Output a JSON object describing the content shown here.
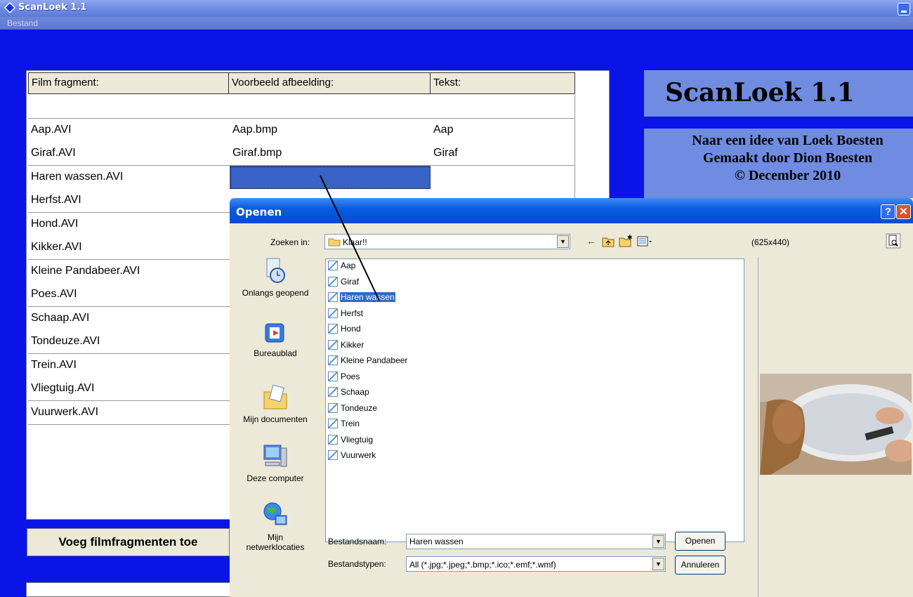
{
  "window": {
    "title": "ScanLoek 1.1"
  },
  "menu": {
    "items": [
      {
        "label": "Bestand"
      }
    ]
  },
  "grid": {
    "headers": [
      "Film fragment:",
      "Voorbeeld afbeelding:",
      "Tekst:"
    ],
    "rows": [
      [
        "",
        "",
        ""
      ],
      [
        "Aap.AVI",
        "Aap.bmp",
        "Aap"
      ],
      [
        "Giraf.AVI",
        "Giraf.bmp",
        "Giraf"
      ],
      [
        "Haren wassen.AVI",
        "",
        ""
      ],
      [
        "Herfst.AVI",
        "",
        ""
      ],
      [
        "Hond.AVI",
        "",
        ""
      ],
      [
        "Kikker.AVI",
        "",
        ""
      ],
      [
        "Kleine Pandabeer.AVI",
        "",
        ""
      ],
      [
        "Poes.AVI",
        "",
        ""
      ],
      [
        "Schaap.AVI",
        "",
        ""
      ],
      [
        "Tondeuze.AVI",
        "",
        ""
      ],
      [
        "Trein.AVI",
        "",
        ""
      ],
      [
        "Vliegtuig.AVI",
        "",
        ""
      ],
      [
        "Vuurwerk.AVI",
        "",
        ""
      ]
    ],
    "selected_row": 3,
    "selected_col": 1
  },
  "side": {
    "title": "ScanLoek 1.1",
    "credits": [
      "Naar een idee van Loek Boesten",
      "Gemaakt door Dion Boesten",
      "© December 2010"
    ]
  },
  "buttons": {
    "add_fragments": "Voeg filmfragmenten toe"
  },
  "dialog": {
    "title": "Openen",
    "look_in_label": "Zoeken in:",
    "look_in_value": "Klaar!!",
    "places": [
      {
        "label": "Onlangs geopend",
        "icon": "recent-icon"
      },
      {
        "label": "Bureaublad",
        "icon": "desktop-icon"
      },
      {
        "label": "Mijn documenten",
        "icon": "documents-icon"
      },
      {
        "label": "Deze computer",
        "icon": "computer-icon"
      },
      {
        "label": "Mijn netwerklocaties",
        "icon": "network-icon"
      }
    ],
    "files": [
      "Aap",
      "Giraf",
      "Haren wassen",
      "Herfst",
      "Hond",
      "Kikker",
      "Kleine Pandabeer",
      "Poes",
      "Schaap",
      "Tondeuze",
      "Trein",
      "Vliegtuig",
      "Vuurwerk"
    ],
    "selected_file": "Haren wassen",
    "filename_label": "Bestandsnaam:",
    "filename_value": "Haren wassen",
    "filetype_label": "Bestandstypen:",
    "filetype_value": "All (*.jpg;*.jpeg;*.bmp;*.ico;*.emf;*.wmf)",
    "open_button": "Openen",
    "cancel_button": "Annuleren",
    "preview_size": "(625x440)"
  },
  "colors": {
    "background": "#0a14e6",
    "panel": "#6f8ce0",
    "selection": "#316ac5"
  }
}
